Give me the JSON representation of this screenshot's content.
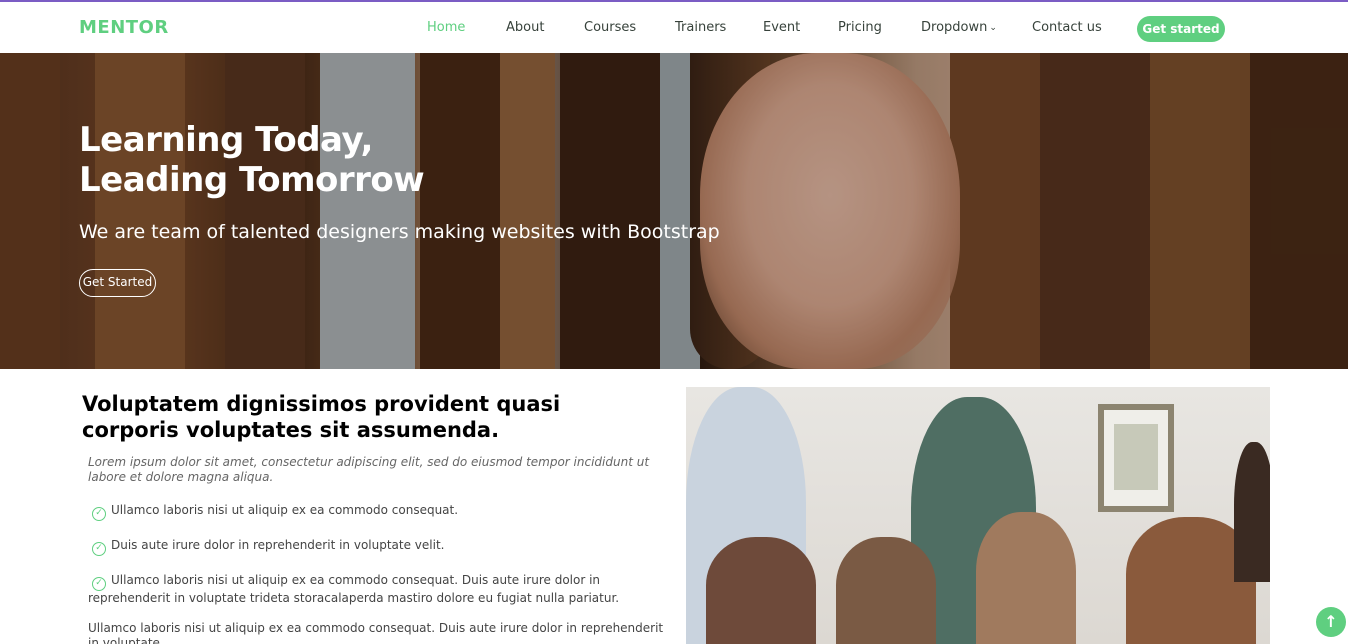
{
  "header": {
    "logo": "MENTOR",
    "nav": [
      {
        "label": "Home",
        "active": true
      },
      {
        "label": "About"
      },
      {
        "label": "Courses"
      },
      {
        "label": "Trainers"
      },
      {
        "label": "Event"
      },
      {
        "label": "Pricing"
      },
      {
        "label": "Dropdown",
        "has_chevron": true
      },
      {
        "label": "Contact us"
      }
    ],
    "cta": "Get started"
  },
  "hero": {
    "title_line1": "Learning Today,",
    "title_line2": "Leading Tomorrow",
    "subtitle": "We are team of talented designers making websites with Bootstrap",
    "button": "Get Started"
  },
  "about": {
    "title": "Voluptatem dignissimos provident quasi corporis voluptates sit assumenda.",
    "lead": "Lorem ipsum dolor sit amet, consectetur adipiscing elit, sed do eiusmod tempor incididunt ut labore et dolore magna aliqua.",
    "checks": [
      "Ullamco laboris nisi ut aliquip ex ea commodo consequat.",
      "Duis aute irure dolor in reprehenderit in voluptate velit.",
      "Ullamco laboris nisi ut aliquip ex ea commodo consequat. Duis aute irure dolor in reprehenderit in voluptate trideta storacalaperda mastiro dolore eu fugiat nulla pariatur."
    ],
    "paragraph": "Ullamco laboris nisi ut aliquip ex ea commodo consequat. Duis aute irure dolor in reprehenderit in voluptate"
  },
  "icons": {
    "check": "check-circle-icon",
    "scroll_top": "arrow-up-icon",
    "dropdown": "chevron-down-icon"
  },
  "colors": {
    "accent": "#5fcf80",
    "topbar": "#7b5cc4",
    "heading": "#000000",
    "text": "#37423b"
  }
}
